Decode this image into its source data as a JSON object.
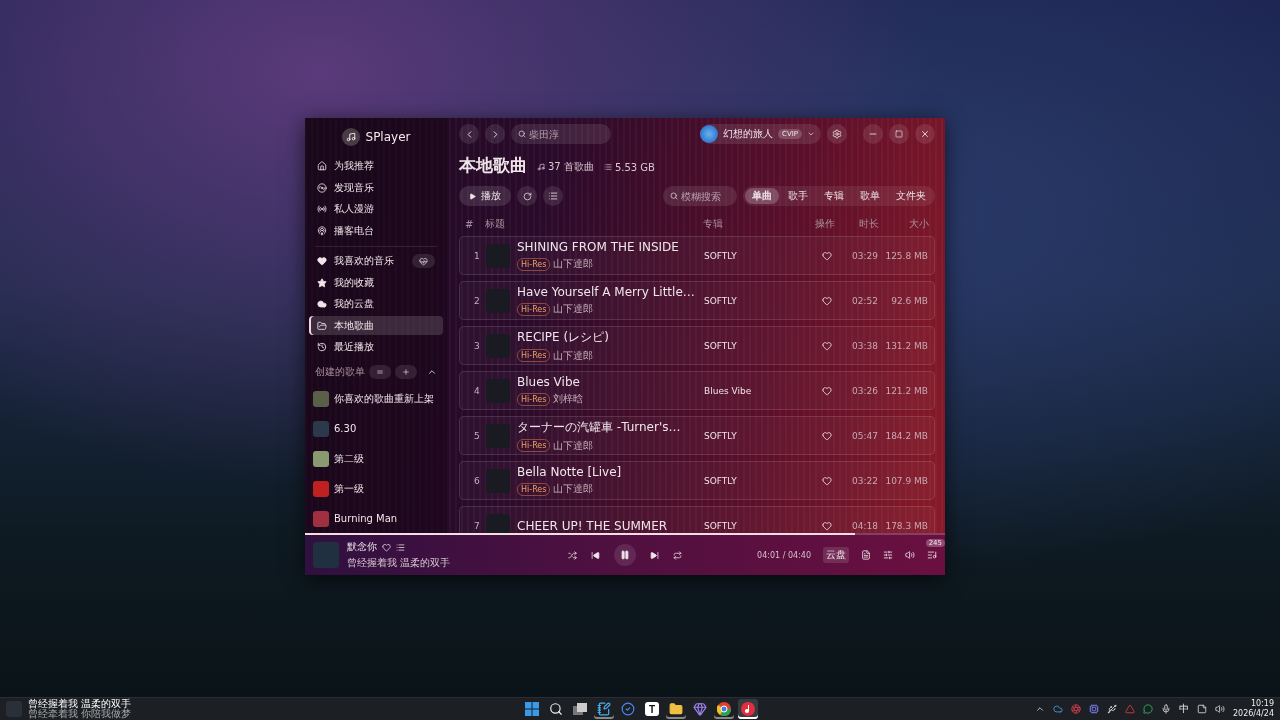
{
  "app": {
    "name": "SPlayer"
  },
  "sidebar": {
    "discover": [
      {
        "label": "为我推荐",
        "selected": false
      },
      {
        "label": "发现音乐",
        "selected": false
      },
      {
        "label": "私人漫游",
        "selected": false
      },
      {
        "label": "播客电台",
        "selected": false
      }
    ],
    "library": [
      {
        "label": "我喜欢的音乐",
        "selected": false,
        "kind": "liked"
      },
      {
        "label": "我的收藏",
        "selected": false,
        "kind": "link"
      },
      {
        "label": "我的云盘",
        "selected": false,
        "kind": "link"
      },
      {
        "label": "本地歌曲",
        "selected": true,
        "kind": "link"
      },
      {
        "label": "最近播放",
        "selected": false,
        "kind": "link"
      }
    ],
    "playlists_header": "创建的歌单",
    "playlists_expanded": true,
    "playlists": [
      {
        "name": "你喜欢的歌曲重新上架",
        "color": "#5a6048"
      },
      {
        "name": "6.30",
        "color": "#2a3a4a"
      },
      {
        "name": "第二级",
        "color": "#8a9a70"
      },
      {
        "name": "第一级",
        "color": "#c02020"
      },
      {
        "name": "Burning Man",
        "color": "#a03040"
      }
    ]
  },
  "topbar": {
    "search_placeholder": "柴田淳",
    "user": {
      "name": "幻想的旅人",
      "badge": "CVIP"
    }
  },
  "page": {
    "title": "本地歌曲",
    "song_count": "37 首歌曲",
    "size": "5.53 GB",
    "play_label": "播放",
    "filter_placeholder": "模糊搜索",
    "tabs": [
      {
        "label": "单曲",
        "selected": true
      },
      {
        "label": "歌手",
        "selected": false
      },
      {
        "label": "专辑",
        "selected": false
      },
      {
        "label": "歌单",
        "selected": false
      },
      {
        "label": "文件夹",
        "selected": false
      }
    ]
  },
  "table": {
    "columns": [
      "#",
      "标题",
      "专辑",
      "操作",
      "时长",
      "大小"
    ],
    "rows": [
      {
        "index": "1",
        "title": "SHINING FROM THE INSIDE",
        "tag": "Hi-Res",
        "artist": "山下達郎",
        "album": "SOFTLY",
        "duration": "03:29",
        "size": "125.8 MB"
      },
      {
        "index": "2",
        "title": "Have Yourself A Merry Little…",
        "tag": "Hi-Res",
        "artist": "山下達郎",
        "album": "SOFTLY",
        "duration": "02:52",
        "size": "92.6 MB"
      },
      {
        "index": "3",
        "title": "RECIPE (レシピ)",
        "tag": "Hi-Res",
        "artist": "山下達郎",
        "album": "SOFTLY",
        "duration": "03:38",
        "size": "131.2 MB"
      },
      {
        "index": "4",
        "title": "Blues Vibe",
        "tag": "Hi-Res",
        "artist": "刘梓晗",
        "album": "Blues Vibe",
        "duration": "03:26",
        "size": "121.2 MB"
      },
      {
        "index": "5",
        "title": "ターナーの汽罐車 -Turner's…",
        "tag": "Hi-Res",
        "artist": "山下達郎",
        "album": "SOFTLY",
        "duration": "05:47",
        "size": "184.2 MB"
      },
      {
        "index": "6",
        "title": "Bella Notte [Live]",
        "tag": "Hi-Res",
        "artist": "山下達郎",
        "album": "SOFTLY",
        "duration": "03:22",
        "size": "107.9 MB"
      },
      {
        "index": "7",
        "title": "CHEER UP! THE SUMMER",
        "album": "SOFTLY",
        "duration": "04:18",
        "size": "178.3 MB"
      }
    ]
  },
  "player": {
    "title": "默念你",
    "lyric": "曾经握着我 温柔的双手",
    "playing": true,
    "progress": {
      "level": 0.86
    },
    "time": "04:01 / 04:40",
    "source": "云盘",
    "queue_count": "245"
  },
  "taskbar": {
    "media": {
      "title": "曾经握着我  温柔的双手",
      "subtitle": "曾经牵着我 你陪我做梦"
    },
    "apps": [
      {
        "kind": "start",
        "running": false,
        "selected": false
      },
      {
        "kind": "search",
        "running": false,
        "selected": false
      },
      {
        "kind": "taskview",
        "running": false,
        "selected": false
      },
      {
        "kind": "notepad",
        "running": true,
        "selected": false
      },
      {
        "kind": "todo",
        "running": false,
        "selected": false
      },
      {
        "kind": "letter",
        "label": "T",
        "running": false,
        "selected": false
      },
      {
        "kind": "folder",
        "running": true,
        "selected": false
      },
      {
        "kind": "gem",
        "running": false,
        "selected": false
      },
      {
        "kind": "browser",
        "running": true,
        "selected": false
      },
      {
        "kind": "music",
        "running": true,
        "selected": true
      }
    ],
    "ime": "中",
    "time": "10:19",
    "date": "2026/4/24"
  }
}
